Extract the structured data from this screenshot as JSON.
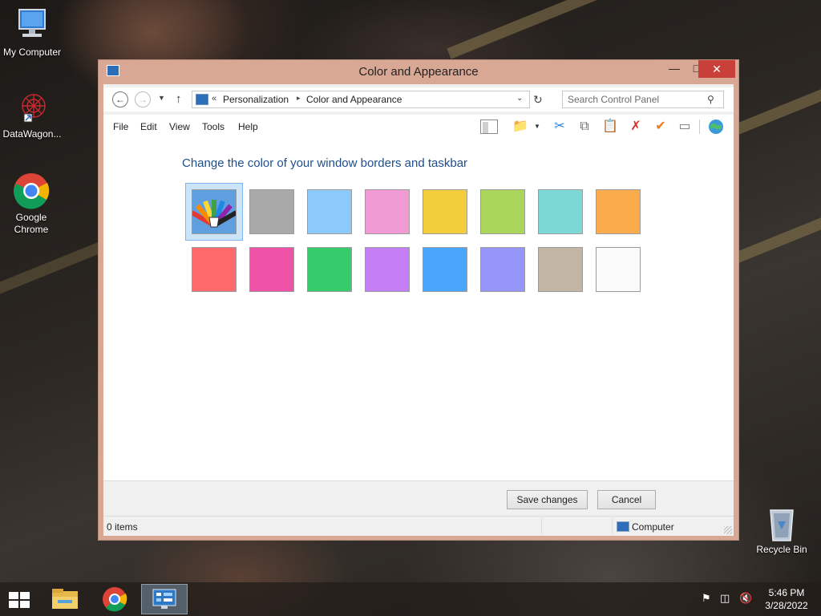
{
  "desktop": {
    "icons": [
      {
        "label": "My Computer"
      },
      {
        "label": "DataWagon..."
      },
      {
        "label": "Google Chrome"
      },
      {
        "label": "Recycle Bin"
      }
    ]
  },
  "window": {
    "title": "Color and Appearance",
    "controls": {
      "minimize": "—",
      "maximize": "□",
      "close": "✕"
    }
  },
  "address": {
    "prefix": "«",
    "crumbs": [
      "Personalization",
      "Color and Appearance"
    ],
    "separator": "▸",
    "search_placeholder": "Search Control Panel"
  },
  "menu": [
    "File",
    "Edit",
    "View",
    "Tools",
    "Help"
  ],
  "toolbar": [
    "layout-icon",
    "folder-check-icon",
    "cut-icon",
    "copy-icon",
    "paste-icon",
    "delete-icon",
    "check-icon",
    "properties-icon",
    "earth-icon"
  ],
  "content": {
    "heading": "Change the color of your window borders and taskbar",
    "swatches": [
      {
        "name": "automatic",
        "color": "#4a90d9",
        "selected": true
      },
      {
        "name": "gray",
        "color": "#a9a9a9"
      },
      {
        "name": "light-blue",
        "color": "#8ec9fb"
      },
      {
        "name": "pink",
        "color": "#f19bd4"
      },
      {
        "name": "yellow",
        "color": "#f2ce3c"
      },
      {
        "name": "lime",
        "color": "#a9d65b"
      },
      {
        "name": "teal",
        "color": "#7bd8d4"
      },
      {
        "name": "orange",
        "color": "#fcab4c"
      },
      {
        "name": "red",
        "color": "#fd6a6b"
      },
      {
        "name": "magenta",
        "color": "#ee53a8"
      },
      {
        "name": "green",
        "color": "#36cc6d"
      },
      {
        "name": "purple",
        "color": "#c47ef6"
      },
      {
        "name": "blue",
        "color": "#4aa6fa"
      },
      {
        "name": "periwinkle",
        "color": "#9696fa"
      },
      {
        "name": "taupe",
        "color": "#c1b5a6"
      },
      {
        "name": "white",
        "color": "#fbfbfb"
      }
    ]
  },
  "buttons": {
    "save": "Save changes",
    "cancel": "Cancel"
  },
  "status": {
    "count": "0 items",
    "zone": "Computer"
  },
  "taskbar": {
    "apps": [
      "windows-logo-icon",
      "file-explorer-icon",
      "chrome-icon",
      "control-panel-icon"
    ],
    "tray_icons": [
      "action-center-flag-icon",
      "network-icon",
      "volume-muted-icon"
    ],
    "time": "5:46 PM",
    "date": "3/28/2022"
  },
  "colors": {
    "window_border": "#d9a894",
    "close_button": "#c9403a",
    "heading": "#1e4e8c",
    "selection": "#cce4f7"
  }
}
